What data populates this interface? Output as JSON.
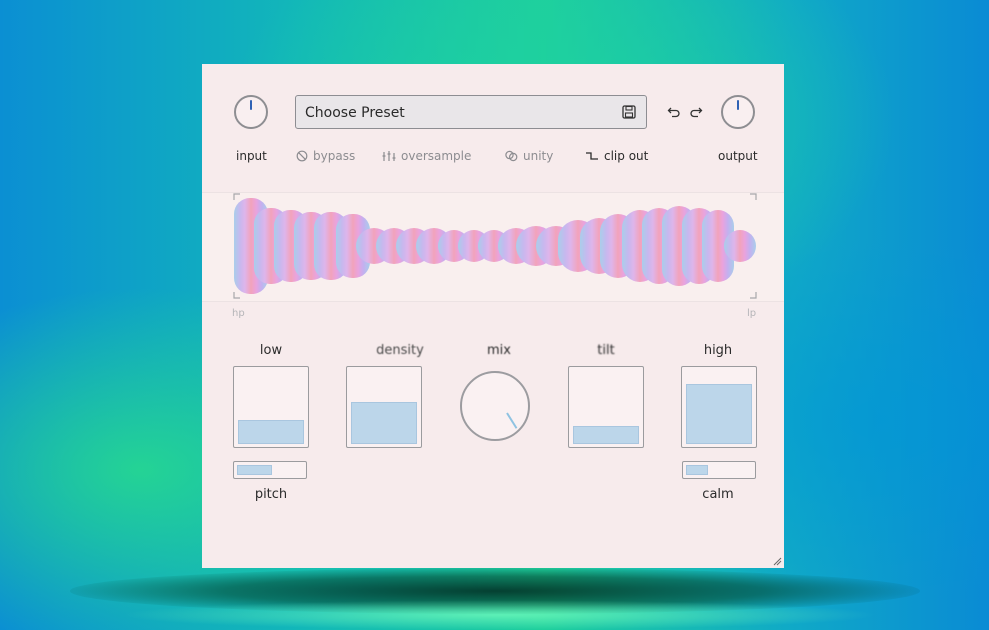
{
  "header": {
    "preset_label": "Choose Preset",
    "input_label": "input",
    "output_label": "output"
  },
  "options": [
    {
      "label": "bypass",
      "icon": "bypass-icon",
      "active": false
    },
    {
      "label": "oversample",
      "icon": "sliders-icon",
      "active": false
    },
    {
      "label": "unity",
      "icon": "unity-icon",
      "active": false
    },
    {
      "label": "clip out",
      "icon": "clip-icon",
      "active": true
    }
  ],
  "visualizer": {
    "left_label": "hp",
    "right_label": "lp"
  },
  "controls": {
    "low": {
      "label": "low",
      "level": 0.3
    },
    "density": {
      "label": "density",
      "level": 0.55
    },
    "mix": {
      "label": "mix"
    },
    "tilt": {
      "label": "tilt",
      "level": 0.22
    },
    "high": {
      "label": "high",
      "level": 0.8
    },
    "pitch": {
      "label": "pitch",
      "level": 0.5
    },
    "calm": {
      "label": "calm",
      "level": 0.3
    }
  },
  "colors": {
    "panel": "#f7ebec",
    "accent_blue": "#bcd6ea",
    "knob_needle": "#2f62b5"
  }
}
